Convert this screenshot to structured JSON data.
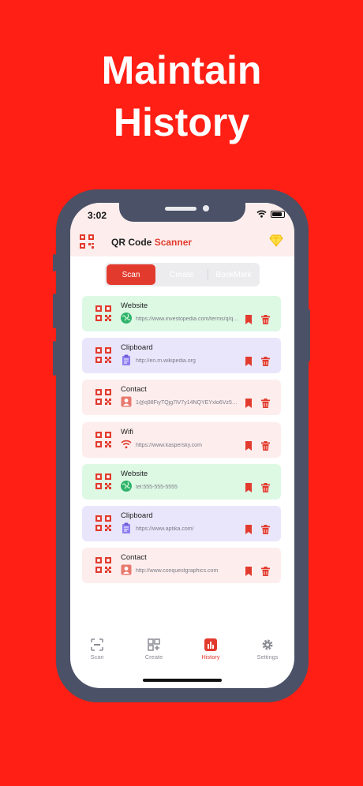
{
  "headline": {
    "line1": "Maintain",
    "line2": "History"
  },
  "status": {
    "time": "3:02"
  },
  "app": {
    "title_part1": "QR Code",
    "title_part2": "Scanner"
  },
  "segments": [
    {
      "label": "Scan",
      "active": true
    },
    {
      "label": "Create",
      "active": false
    },
    {
      "label": "BookMark",
      "active": false
    }
  ],
  "history": [
    {
      "title": "Website",
      "icon": "globe-icon",
      "content": "https://www.investopedia.com/terms/q/quick-response-qr-code.asp",
      "bg": "#ddf9e4"
    },
    {
      "title": "Clipboard",
      "icon": "clipboard-icon",
      "content": "http://en.m.wikipedia.org",
      "bg": "#e9e6fb"
    },
    {
      "title": "Contact",
      "icon": "contact-icon",
      "content": "1@q98FiyTQjg7lV7y14NQYEYxlo6Vz5aYDzVRs",
      "bg": "#fdeeed"
    },
    {
      "title": "Wifi",
      "icon": "wifi-icon",
      "content": "https://www.kaspersky.com",
      "bg": "#fdeeed"
    },
    {
      "title": "Website",
      "icon": "globe-icon",
      "content": "tel:555-555-5555",
      "bg": "#ddf9e4"
    },
    {
      "title": "Clipboard",
      "icon": "clipboard-icon",
      "content": "https://www.aptika.com/",
      "bg": "#e9e6fb"
    },
    {
      "title": "Contact",
      "icon": "contact-icon",
      "content": "http://www.conquestgraphics.com",
      "bg": "#fdeeed"
    }
  ],
  "tabs": [
    {
      "label": "Scan",
      "icon": "scan-icon",
      "active": false
    },
    {
      "label": "Create",
      "icon": "create-qr-icon",
      "active": false
    },
    {
      "label": "History",
      "icon": "history-chart-icon",
      "active": true
    },
    {
      "label": "Settings",
      "icon": "gear-icon",
      "active": false
    }
  ],
  "colors": {
    "background": "#ff1f14",
    "accent": "#e23b2e",
    "frame": "#4b5166",
    "header": "#fdeeed"
  }
}
